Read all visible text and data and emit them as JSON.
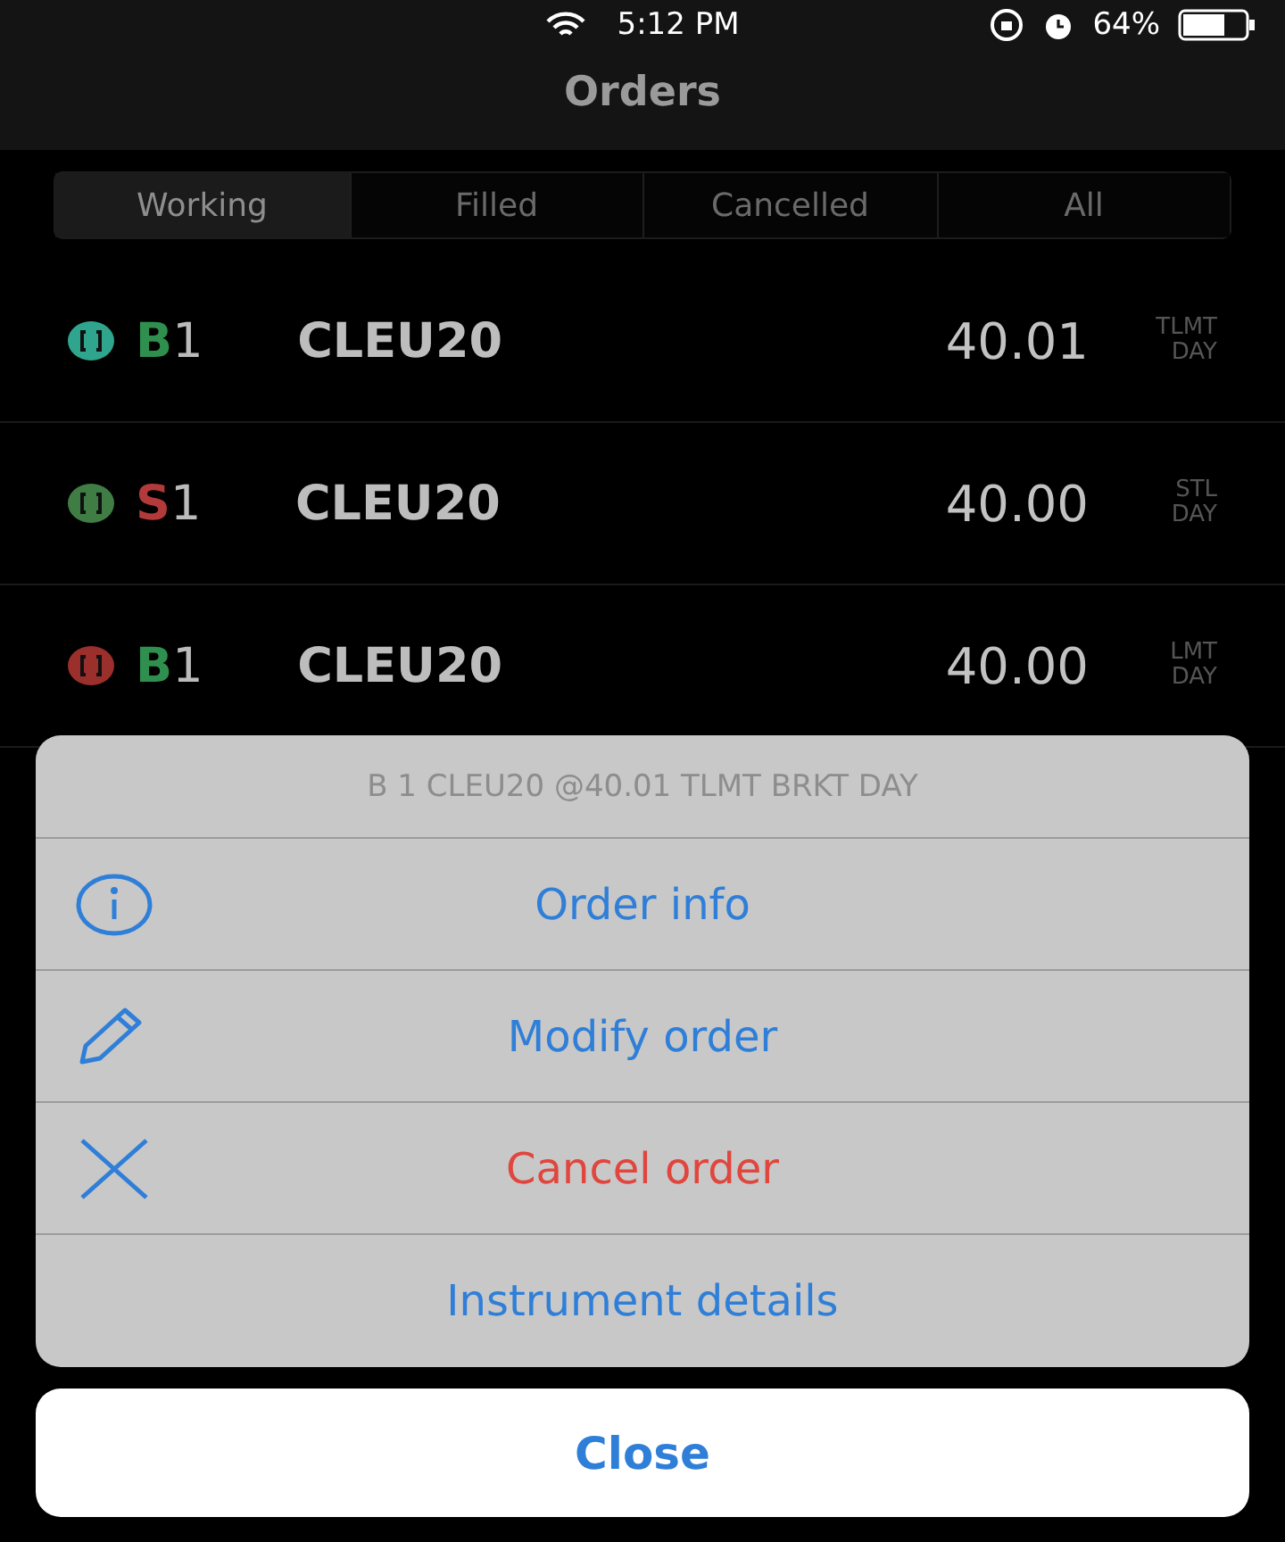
{
  "status_bar": {
    "time": "5:12 PM",
    "battery": "64%"
  },
  "title": "Orders",
  "tabs": [
    {
      "label": "Working",
      "selected": true
    },
    {
      "label": "Filled",
      "selected": false
    },
    {
      "label": "Cancelled",
      "selected": false
    },
    {
      "label": "All",
      "selected": false
    }
  ],
  "orders": [
    {
      "color": "#2fa58e",
      "side": "B",
      "kind": "buy",
      "quantity": "1",
      "symbol": "CLEU20",
      "price": "40.01",
      "type": "TLMT",
      "duration": "DAY"
    },
    {
      "color": "#3f7d45",
      "side": "S",
      "kind": "sell",
      "quantity": "1",
      "symbol": "CLEU20",
      "price": "40.00",
      "type": "STL",
      "duration": "DAY"
    },
    {
      "color": "#9a2f2b",
      "side": "B",
      "kind": "buy",
      "quantity": "1",
      "symbol": "CLEU20",
      "price": "40.00",
      "type": "LMT",
      "duration": "DAY"
    }
  ],
  "action_sheet": {
    "header": "B 1 CLEU20 @40.01 TLMT BRKT DAY",
    "actions": [
      {
        "label": "Order info",
        "kind": "info",
        "destructive": false
      },
      {
        "label": "Modify order",
        "kind": "modify",
        "destructive": false
      },
      {
        "label": "Cancel order",
        "kind": "cancel",
        "destructive": true
      },
      {
        "label": "Instrument details",
        "kind": "plain",
        "destructive": false
      }
    ],
    "close": "Close"
  }
}
